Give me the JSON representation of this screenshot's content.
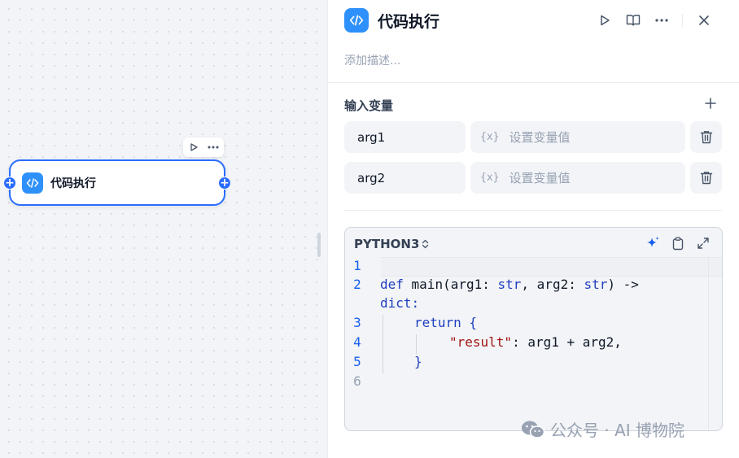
{
  "canvas": {
    "node": {
      "title": "代码执行"
    },
    "handles": {
      "left": "+",
      "right": "+"
    }
  },
  "panel": {
    "title": "代码执行",
    "description_placeholder": "添加描述...",
    "input_section": {
      "title": "输入变量"
    },
    "variables": [
      {
        "name": "arg1",
        "placeholder": "设置变量值",
        "var_icon": "{x}"
      },
      {
        "name": "arg2",
        "placeholder": "设置变量值",
        "var_icon": "{x}"
      }
    ],
    "code_editor": {
      "language": "PYTHON3",
      "line_numbers": [
        "1",
        "2",
        "3",
        "4",
        "5",
        "6"
      ],
      "lines": {
        "l2a_kw": "def",
        "l2a_name": " main(arg1: ",
        "l2a_t1": "str",
        "l2a_mid": ", arg2: ",
        "l2a_t2": "str",
        "l2a_end": ") ->",
        "l2b": "dict:",
        "l3_kw": "return",
        "l3_end": " {",
        "l4_str": "\"result\"",
        "l4_end": ": arg1 + arg2,",
        "l5": "}"
      }
    }
  },
  "watermark": {
    "text": "公众号 · AI 博物院"
  },
  "colors": {
    "accent": "#296dff",
    "icon_bg": "#2e90fa"
  }
}
